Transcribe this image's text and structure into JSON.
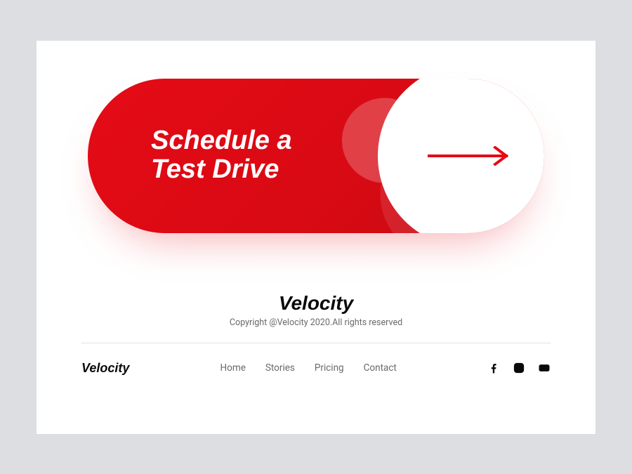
{
  "cta": {
    "title": "Schedule a\nTest Drive",
    "accent": "#e40b16"
  },
  "brand": {
    "name": "Velocity",
    "copyright": "Copyright @Velocity 2020.All rights reserved"
  },
  "footer": {
    "logo": "Velocity",
    "nav": {
      "home": "Home",
      "stories": "Stories",
      "pricing": "Pricing",
      "contact": "Contact"
    }
  }
}
